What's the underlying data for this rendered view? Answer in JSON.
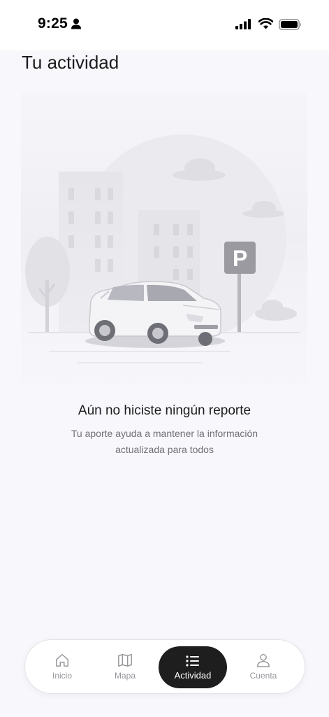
{
  "status_bar": {
    "time": "9:25",
    "icons": [
      "person-icon",
      "cellular-signal-icon",
      "wifi-icon",
      "battery-icon"
    ]
  },
  "page": {
    "title": "Tu actividad"
  },
  "illustration": {
    "parking_sign": "P",
    "icon": "empty-activity-illustration"
  },
  "empty_state": {
    "title": "Aún no hiciste ningún reporte",
    "subtitle_line1": "Tu aporte ayuda a mantener la información",
    "subtitle_line2": "actualizada para todos"
  },
  "tab_bar": {
    "active": "Actividad",
    "items": [
      {
        "label": "Inicio",
        "icon": "home-icon"
      },
      {
        "label": "Mapa",
        "icon": "map-icon"
      },
      {
        "label": "Actividad",
        "icon": "list-icon"
      },
      {
        "label": "Cuenta",
        "icon": "user-icon"
      }
    ]
  },
  "colors": {
    "background": "#f8f8fc",
    "active_tab": "#1e1e1e",
    "inactive_tab_text": "#96969c",
    "subtitle_text": "#6f6f76"
  }
}
